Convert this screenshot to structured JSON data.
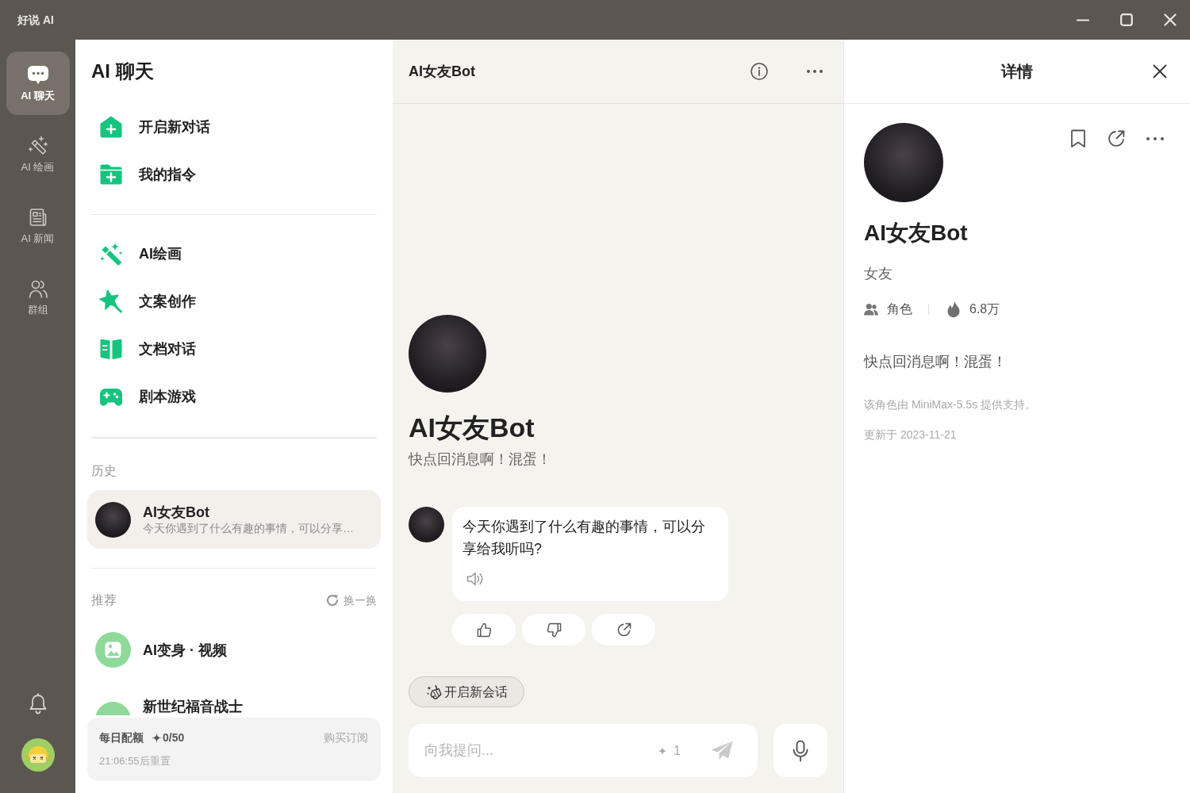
{
  "window": {
    "title": "好说 AI"
  },
  "nav_rail": {
    "items": [
      {
        "label": "AI 聊天",
        "selected": true
      },
      {
        "label": "AI 绘画",
        "selected": false
      },
      {
        "label": "AI 新闻",
        "selected": false
      },
      {
        "label": "群组",
        "selected": false
      }
    ]
  },
  "sidebar": {
    "title": "AI 聊天",
    "actions": [
      {
        "label": "开启新对话"
      },
      {
        "label": "我的指令"
      }
    ],
    "tools": [
      {
        "label": "AI绘画"
      },
      {
        "label": "文案创作"
      },
      {
        "label": "文档对话"
      },
      {
        "label": "剧本游戏"
      }
    ],
    "history": {
      "heading": "历史",
      "items": [
        {
          "name": "AI女友Bot",
          "preview": "今天你遇到了什么有趣的事情，可以分享…",
          "selected": true
        }
      ]
    },
    "recommended": {
      "heading": "推荐",
      "refresh": "换一换",
      "items": [
        {
          "name": "AI变身 · 视频"
        },
        {
          "name": "新世纪福音战士"
        }
      ]
    },
    "quota": {
      "label": "每日配额",
      "count": "0/50",
      "buy": "购买订阅",
      "reset": "21:06:55后重置"
    }
  },
  "chat": {
    "title": "AI女友Bot",
    "intro": {
      "name": "AI女友Bot",
      "tagline": "快点回消息啊！混蛋！"
    },
    "messages": [
      {
        "text": "今天你遇到了什么有趣的事情，可以分享给我听吗?"
      }
    ],
    "new_chat_button": "开启新会话",
    "input": {
      "placeholder": "向我提问...",
      "cost": "1"
    }
  },
  "details": {
    "title": "详情",
    "name": "AI女友Bot",
    "category": "女友",
    "type": "角色",
    "popularity": "6.8万",
    "description": "快点回消息啊！混蛋！",
    "model_note": "该角色由 MiniMax-5.5s 提供支持。",
    "updated": "更新于 2023-11-21"
  }
}
